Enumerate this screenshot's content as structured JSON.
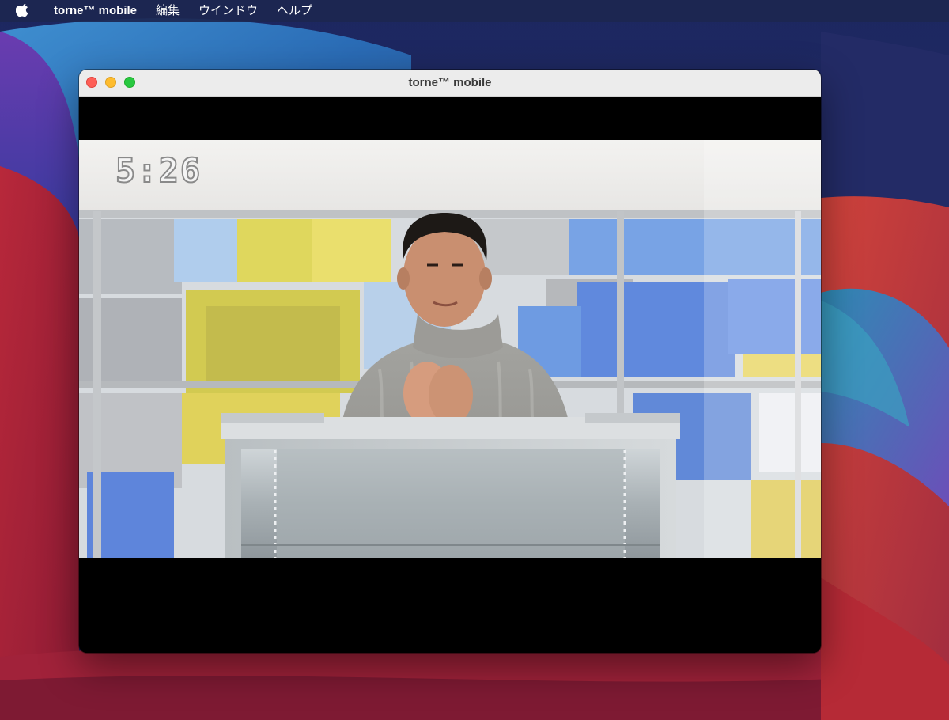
{
  "menubar": {
    "app_name": "torne™ mobile",
    "items": [
      "編集",
      "ウインドウ",
      "ヘルプ"
    ]
  },
  "window": {
    "title": "torne™ mobile"
  },
  "video": {
    "timer": "5:26"
  },
  "colors": {
    "close": "#fe5f57",
    "minimize": "#febc2e",
    "maximize": "#28c840"
  },
  "icons": [
    "apple-icon"
  ]
}
